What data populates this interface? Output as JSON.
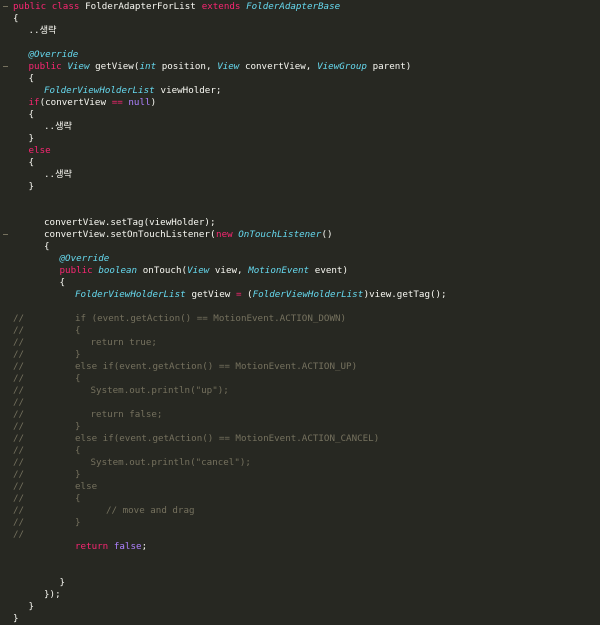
{
  "editor": {
    "lines": [
      {
        "tokens": [
          {
            "t": "public class ",
            "c": "kw"
          },
          {
            "t": "FolderAdapterForList ",
            "c": "plain"
          },
          {
            "t": "extends ",
            "c": "kw"
          },
          {
            "t": "FolderAdapterBase",
            "c": "type"
          }
        ]
      },
      {
        "tokens": [
          {
            "t": "{",
            "c": "plain"
          }
        ]
      },
      {
        "tokens": [
          {
            "t": "\t..",
            "c": "plain"
          },
          {
            "t": "생략",
            "c": "ko"
          }
        ]
      },
      {
        "tokens": []
      },
      {
        "tokens": [
          {
            "t": "\t@Override",
            "c": "ann"
          }
        ]
      },
      {
        "tokens": [
          {
            "t": "\tpublic ",
            "c": "kw"
          },
          {
            "t": "View ",
            "c": "type"
          },
          {
            "t": "getView(",
            "c": "plain"
          },
          {
            "t": "int ",
            "c": "type"
          },
          {
            "t": "position, ",
            "c": "plain"
          },
          {
            "t": "View ",
            "c": "type"
          },
          {
            "t": "convertView, ",
            "c": "plain"
          },
          {
            "t": "ViewGroup ",
            "c": "type"
          },
          {
            "t": "parent)",
            "c": "plain"
          }
        ]
      },
      {
        "tokens": [
          {
            "t": "\t{",
            "c": "plain"
          }
        ]
      },
      {
        "tokens": [
          {
            "t": "\t\tFolderViewHolderList ",
            "c": "type"
          },
          {
            "t": "viewHolder;",
            "c": "plain"
          }
        ]
      },
      {
        "tokens": [
          {
            "t": "\tif",
            "c": "kw"
          },
          {
            "t": "(convertView ",
            "c": "plain"
          },
          {
            "t": "== ",
            "c": "kw"
          },
          {
            "t": "null",
            "c": "num"
          },
          {
            "t": ")",
            "c": "plain"
          }
        ]
      },
      {
        "tokens": [
          {
            "t": "\t{",
            "c": "plain"
          }
        ]
      },
      {
        "tokens": [
          {
            "t": "\t\t..",
            "c": "plain"
          },
          {
            "t": "생략",
            "c": "ko"
          }
        ]
      },
      {
        "tokens": [
          {
            "t": "\t}",
            "c": "plain"
          }
        ]
      },
      {
        "tokens": [
          {
            "t": "\telse",
            "c": "kw"
          }
        ]
      },
      {
        "tokens": [
          {
            "t": "\t{",
            "c": "plain"
          }
        ]
      },
      {
        "tokens": [
          {
            "t": "\t\t..",
            "c": "plain"
          },
          {
            "t": "생략",
            "c": "ko"
          }
        ]
      },
      {
        "tokens": [
          {
            "t": "\t}",
            "c": "plain"
          }
        ]
      },
      {
        "tokens": []
      },
      {
        "tokens": []
      },
      {
        "tokens": [
          {
            "t": "\t\tconvertView.setTag(viewHolder);",
            "c": "plain"
          }
        ]
      },
      {
        "tokens": [
          {
            "t": "\t\tconvertView.setOnTouchListener(",
            "c": "plain"
          },
          {
            "t": "new ",
            "c": "kw"
          },
          {
            "t": "OnTouchListener",
            "c": "type"
          },
          {
            "t": "()",
            "c": "plain"
          }
        ]
      },
      {
        "tokens": [
          {
            "t": "\t\t{",
            "c": "plain"
          }
        ]
      },
      {
        "tokens": [
          {
            "t": "\t\t\t@Override",
            "c": "ann"
          }
        ]
      },
      {
        "tokens": [
          {
            "t": "\t\t\tpublic ",
            "c": "kw"
          },
          {
            "t": "boolean ",
            "c": "type"
          },
          {
            "t": "onTouch(",
            "c": "plain"
          },
          {
            "t": "View ",
            "c": "type"
          },
          {
            "t": "view, ",
            "c": "plain"
          },
          {
            "t": "MotionEvent ",
            "c": "type"
          },
          {
            "t": "event)",
            "c": "plain"
          }
        ]
      },
      {
        "tokens": [
          {
            "t": "\t\t\t{",
            "c": "plain"
          }
        ]
      },
      {
        "tokens": [
          {
            "t": "\t\t\t\tFolderViewHolderList ",
            "c": "type"
          },
          {
            "t": "getView ",
            "c": "plain"
          },
          {
            "t": "= ",
            "c": "kw"
          },
          {
            "t": "(",
            "c": "plain"
          },
          {
            "t": "FolderViewHolderList",
            "c": "type"
          },
          {
            "t": ")view.getTag();",
            "c": "plain"
          }
        ]
      },
      {
        "tokens": []
      },
      {
        "tokens": [
          {
            "t": "//\t\t\t\tif (event.getAction() == MotionEvent.ACTION_DOWN)",
            "c": "cm"
          }
        ]
      },
      {
        "tokens": [
          {
            "t": "//\t\t\t\t{",
            "c": "cm"
          }
        ]
      },
      {
        "tokens": [
          {
            "t": "//\t\t\t\t\treturn true;",
            "c": "cm"
          }
        ]
      },
      {
        "tokens": [
          {
            "t": "//\t\t\t\t}",
            "c": "cm"
          }
        ]
      },
      {
        "tokens": [
          {
            "t": "//\t\t\t\telse if(event.getAction() == MotionEvent.ACTION_UP)",
            "c": "cm"
          }
        ]
      },
      {
        "tokens": [
          {
            "t": "//\t\t\t\t{",
            "c": "cm"
          }
        ]
      },
      {
        "tokens": [
          {
            "t": "//\t\t\t\t\tSystem.out.println(\"up\");",
            "c": "cm"
          }
        ]
      },
      {
        "tokens": [
          {
            "t": "//",
            "c": "cm"
          }
        ]
      },
      {
        "tokens": [
          {
            "t": "//\t\t\t\t\treturn false;",
            "c": "cm"
          }
        ]
      },
      {
        "tokens": [
          {
            "t": "//\t\t\t\t}",
            "c": "cm"
          }
        ]
      },
      {
        "tokens": [
          {
            "t": "//\t\t\t\telse if(event.getAction() == MotionEvent.ACTION_CANCEL)",
            "c": "cm"
          }
        ]
      },
      {
        "tokens": [
          {
            "t": "//\t\t\t\t{",
            "c": "cm"
          }
        ]
      },
      {
        "tokens": [
          {
            "t": "//\t\t\t\t\tSystem.out.println(\"cancel\");",
            "c": "cm"
          }
        ]
      },
      {
        "tokens": [
          {
            "t": "//\t\t\t\t}",
            "c": "cm"
          }
        ]
      },
      {
        "tokens": [
          {
            "t": "//\t\t\t\telse",
            "c": "cm"
          }
        ]
      },
      {
        "tokens": [
          {
            "t": "//\t\t\t\t{",
            "c": "cm"
          }
        ]
      },
      {
        "tokens": [
          {
            "t": "//\t\t\t\t\t\t// move and drag",
            "c": "cm"
          }
        ]
      },
      {
        "tokens": [
          {
            "t": "//\t\t\t\t}",
            "c": "cm"
          }
        ]
      },
      {
        "tokens": [
          {
            "t": "//",
            "c": "cm"
          }
        ]
      },
      {
        "tokens": [
          {
            "t": "\t\t\t\treturn ",
            "c": "kw"
          },
          {
            "t": "false",
            "c": "num"
          },
          {
            "t": ";",
            "c": "plain"
          }
        ]
      },
      {
        "tokens": []
      },
      {
        "tokens": []
      },
      {
        "tokens": [
          {
            "t": "\t\t\t}",
            "c": "plain"
          }
        ]
      },
      {
        "tokens": [
          {
            "t": "\t\t});",
            "c": "plain"
          }
        ]
      },
      {
        "tokens": [
          {
            "t": "\t}",
            "c": "plain"
          }
        ]
      },
      {
        "tokens": [
          {
            "t": "}",
            "c": "plain"
          }
        ]
      }
    ],
    "colors": {
      "background": "#272822",
      "keyword": "#f92672",
      "type": "#66d9ef",
      "number": "#ae81ff",
      "comment": "#75715e",
      "text": "#f8f8f2"
    }
  }
}
